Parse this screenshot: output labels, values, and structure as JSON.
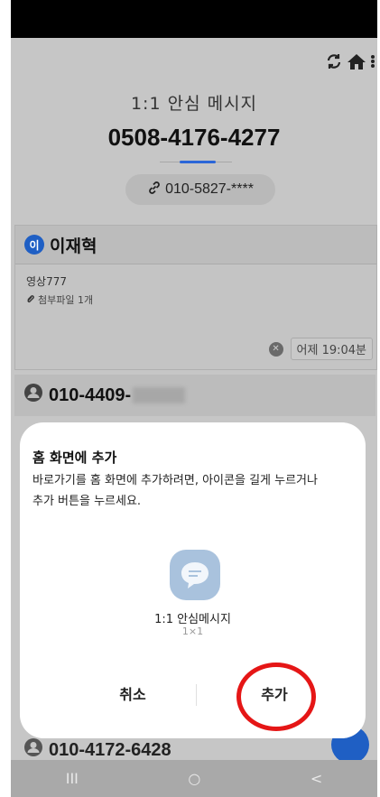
{
  "header": {
    "title": "1:1 안심 메시지",
    "number": "0508-4176-4277",
    "linked_number": "010-5827-****",
    "icons": [
      "refresh-icon",
      "home-icon",
      "more-icon"
    ]
  },
  "message_card": {
    "badge": "이",
    "name": "이재혁",
    "text": "영상777",
    "attachment": "첨부파일 1개",
    "time": "어제 19:04분"
  },
  "contact2": {
    "number_prefix": "010-4409-"
  },
  "contact3": {
    "number": "010-4172-6428"
  },
  "dialog": {
    "title": "홈 화면에 추가",
    "description": "바로가기를 홈 화면에 추가하려면, 아이콘을 길게 누르거나 추가 버튼을 누르세요.",
    "app_name": "1:1 안심메시지",
    "app_size": "1×1",
    "cancel_label": "취소",
    "add_label": "추가"
  },
  "navbar": {
    "recent": "III",
    "home": "○",
    "back": "<"
  },
  "colors": {
    "accent": "#1f5fc4",
    "highlight_ring": "#e51616"
  }
}
